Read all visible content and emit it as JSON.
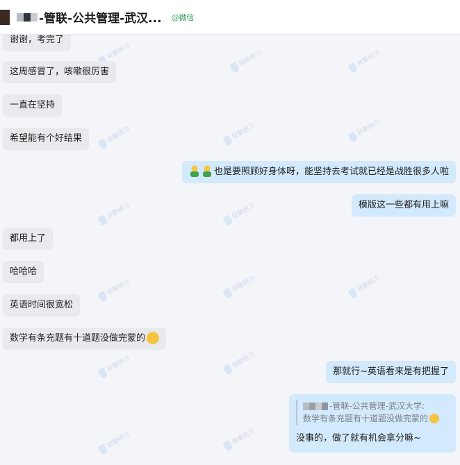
{
  "header": {
    "title": "-管联-公共管理-武汉...",
    "source": "@微信"
  },
  "messages": [
    {
      "dir": "in",
      "text": "谢谢，考完了"
    },
    {
      "dir": "in",
      "text": "这周感冒了，咳嗽很厉害"
    },
    {
      "dir": "in",
      "text": "一直在坚持"
    },
    {
      "dir": "in",
      "text": "希望能有个好结果"
    },
    {
      "dir": "out",
      "text": "也是要照顾好身体呀，能坚持去考试就已经是战胜很多人啦",
      "emoji": "two-person-emoji"
    },
    {
      "dir": "out",
      "text": "模版这一些都有用上嘛"
    },
    {
      "dir": "in",
      "text": "都用上了"
    },
    {
      "dir": "in",
      "text": "哈哈哈"
    },
    {
      "dir": "in",
      "text": "英语时间很宽松"
    },
    {
      "dir": "in",
      "text": "数学有条充题有十道题没做完蒙的",
      "emoji": "laugh-emoji"
    },
    {
      "dir": "out",
      "text": "那就行~英语看来是有把握了"
    }
  ],
  "quote": {
    "name": "-管联-公共管理-武汉大学:",
    "text": "数学有条充题有十道题没做完蒙的",
    "reply": "没事的，做了就有机会拿分嘛~"
  },
  "watermark": "领聚研习",
  "colors": {
    "incoming_bubble": "#e9eaee",
    "outgoing_bubble": "#d3e9fc",
    "source_green": "#2e9b53"
  }
}
